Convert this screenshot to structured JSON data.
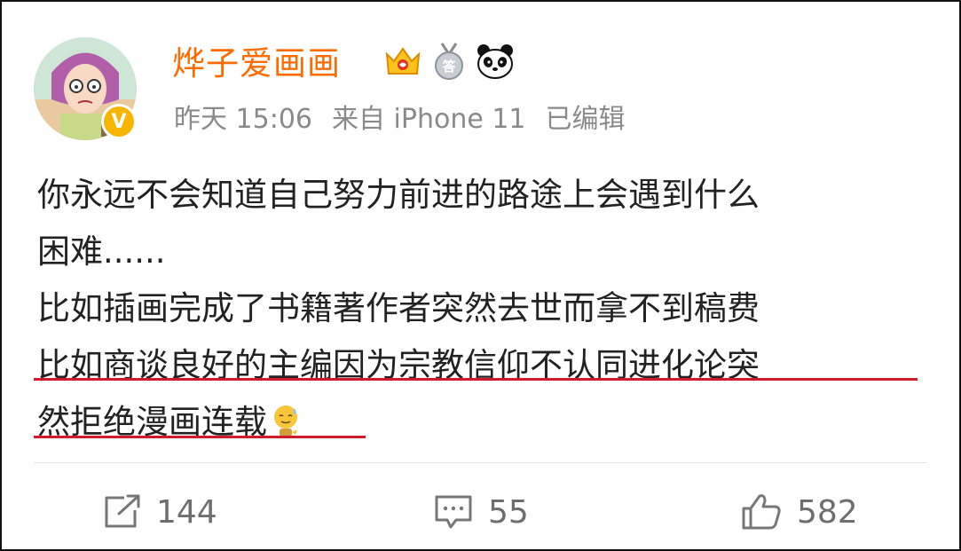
{
  "user": {
    "name": "烨子爱画画",
    "verified_mark": "V",
    "badges": [
      "crown-icon",
      "medal-icon",
      "panda-icon"
    ]
  },
  "post": {
    "time": "昨天 15:06",
    "source": "来自 iPhone 11",
    "edited": "已编辑",
    "lines": [
      "你永远不会知道自己努力前进的路途上会遇到什么",
      "困难......",
      "比如插画完成了书籍著作者突然去世而拿不到稿费",
      "比如商谈良好的主编因为宗教信仰不认同进化论突",
      "然拒绝漫画连载"
    ],
    "emoji": "sweat-smile-emoji"
  },
  "actions": {
    "repost_count": "144",
    "comment_count": "55",
    "like_count": "582"
  },
  "colors": {
    "username": "#ff6b00",
    "text": "#222222",
    "meta": "#8a8a8a",
    "underline": "#d11a2a",
    "verified": "#f7b500"
  }
}
